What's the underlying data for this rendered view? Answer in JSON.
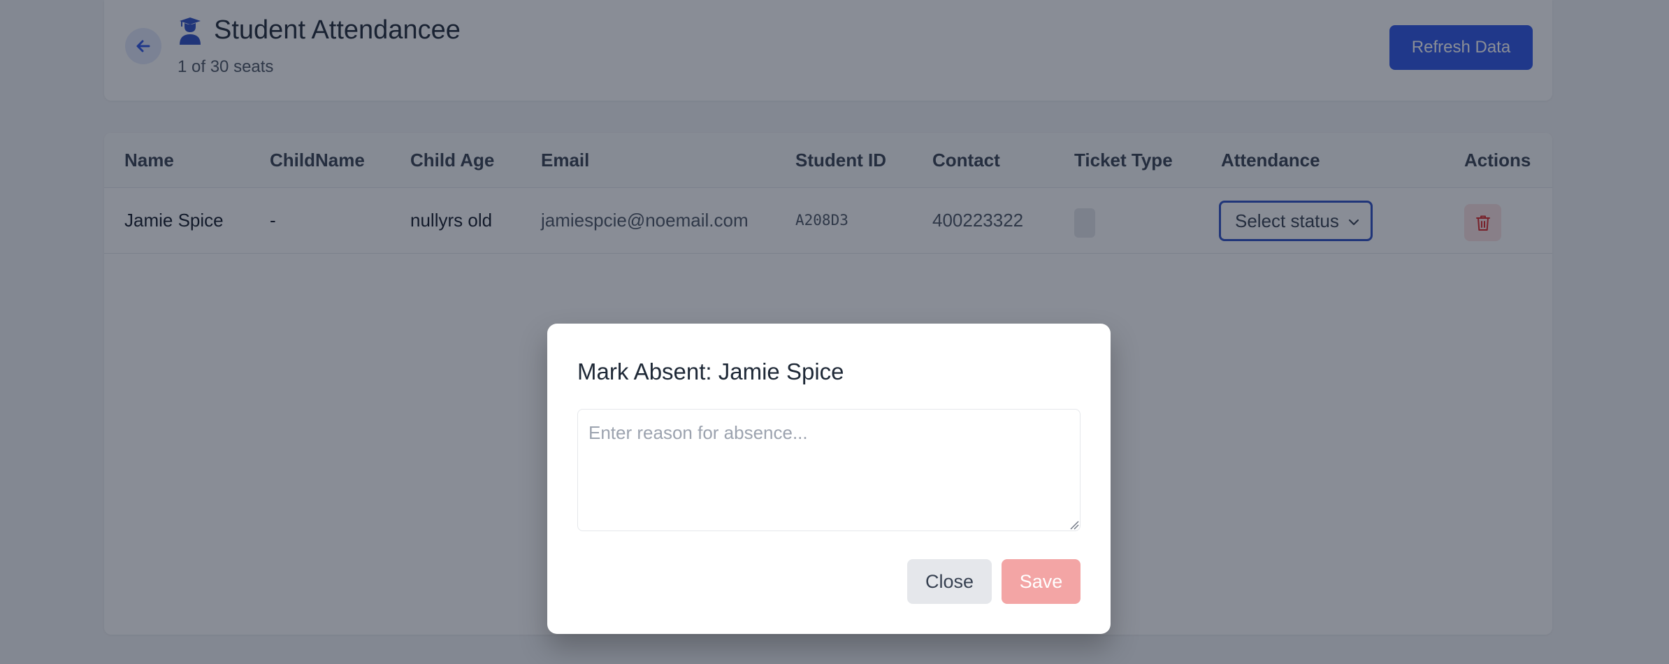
{
  "header": {
    "title": "Student Attendancee",
    "subtitle": "1 of 30 seats",
    "refresh_label": "Refresh Data",
    "back_icon": "arrow-left-icon",
    "title_icon": "graduate-user-icon"
  },
  "table": {
    "columns": [
      "Name",
      "ChildName",
      "Child Age",
      "Email",
      "Student ID",
      "Contact",
      "Ticket Type",
      "Attendance",
      "Actions"
    ],
    "rows": [
      {
        "name": "Jamie Spice",
        "child_name": "-",
        "child_age": "nullyrs old",
        "email": "jamiespcie@noemail.com",
        "student_id": "A208D3",
        "contact": "400223322",
        "ticket_type": "",
        "attendance": "Select status",
        "delete_icon": "trash-icon"
      }
    ]
  },
  "modal": {
    "title": "Mark Absent: Jamie Spice",
    "reason_placeholder": "Enter reason for absence...",
    "reason_value": "",
    "close_label": "Close",
    "save_label": "Save"
  },
  "colors": {
    "primary": "#2d55e6",
    "danger_light": "#f3a5a5",
    "overlay": "rgba(20,28,46,0.50)"
  }
}
